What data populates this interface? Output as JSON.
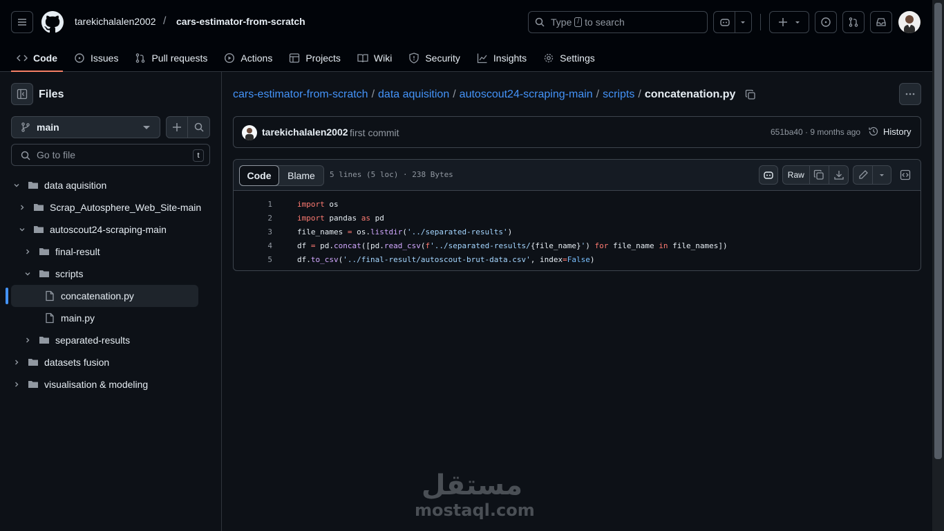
{
  "header": {
    "owner": "tarekichalalen2002",
    "separator": "/",
    "repo": "cars-estimator-from-scratch",
    "search_prefix": "Type",
    "search_key": "/",
    "search_suffix": "to search"
  },
  "tabs": [
    {
      "label": "Code",
      "icon": "code-icon"
    },
    {
      "label": "Issues",
      "icon": "issue-icon"
    },
    {
      "label": "Pull requests",
      "icon": "pull-request-icon"
    },
    {
      "label": "Actions",
      "icon": "play-icon"
    },
    {
      "label": "Projects",
      "icon": "table-icon"
    },
    {
      "label": "Wiki",
      "icon": "book-icon"
    },
    {
      "label": "Security",
      "icon": "shield-icon"
    },
    {
      "label": "Insights",
      "icon": "graph-icon"
    },
    {
      "label": "Settings",
      "icon": "gear-icon"
    }
  ],
  "sidebar": {
    "title": "Files",
    "branch": "main",
    "goto_placeholder": "Go to file",
    "goto_key": "t",
    "tree": [
      {
        "label": "data aquisition",
        "type": "folder",
        "expanded": true
      },
      {
        "label": "Scrap_Autosphere_Web_Site-main",
        "type": "folder",
        "expanded": false
      },
      {
        "label": "autoscout24-scraping-main",
        "type": "folder",
        "expanded": true
      },
      {
        "label": "final-result",
        "type": "folder",
        "expanded": false
      },
      {
        "label": "scripts",
        "type": "folder",
        "expanded": true
      },
      {
        "label": "concatenation.py",
        "type": "file",
        "selected": true
      },
      {
        "label": "main.py",
        "type": "file"
      },
      {
        "label": "separated-results",
        "type": "folder",
        "expanded": false
      },
      {
        "label": "datasets fusion",
        "type": "folder",
        "expanded": false
      },
      {
        "label": "visualisation & modeling",
        "type": "folder",
        "expanded": false
      }
    ]
  },
  "breadcrumb": {
    "parts": [
      "cars-estimator-from-scratch",
      "data aquisition",
      "autoscout24-scraping-main",
      "scripts"
    ],
    "sep": "/",
    "current": "concatenation.py"
  },
  "commit": {
    "author": "tarekichalalen2002",
    "message": "first commit",
    "meta": "651ba40 · 9 months ago",
    "history": "History"
  },
  "file": {
    "tab_code": "Code",
    "tab_blame": "Blame",
    "info": "5 lines (5 loc) · 238 Bytes",
    "raw": "Raw",
    "line_numbers": [
      "1",
      "2",
      "3",
      "4",
      "5"
    ]
  },
  "watermark": {
    "arabic": "مستقل",
    "latin": "mostaql.com"
  },
  "colors": {
    "accent_tab": "#f78166",
    "link": "#4493f8",
    "keyword": "#ff7b72",
    "function": "#d2a8ff",
    "string": "#a5d6ff"
  }
}
